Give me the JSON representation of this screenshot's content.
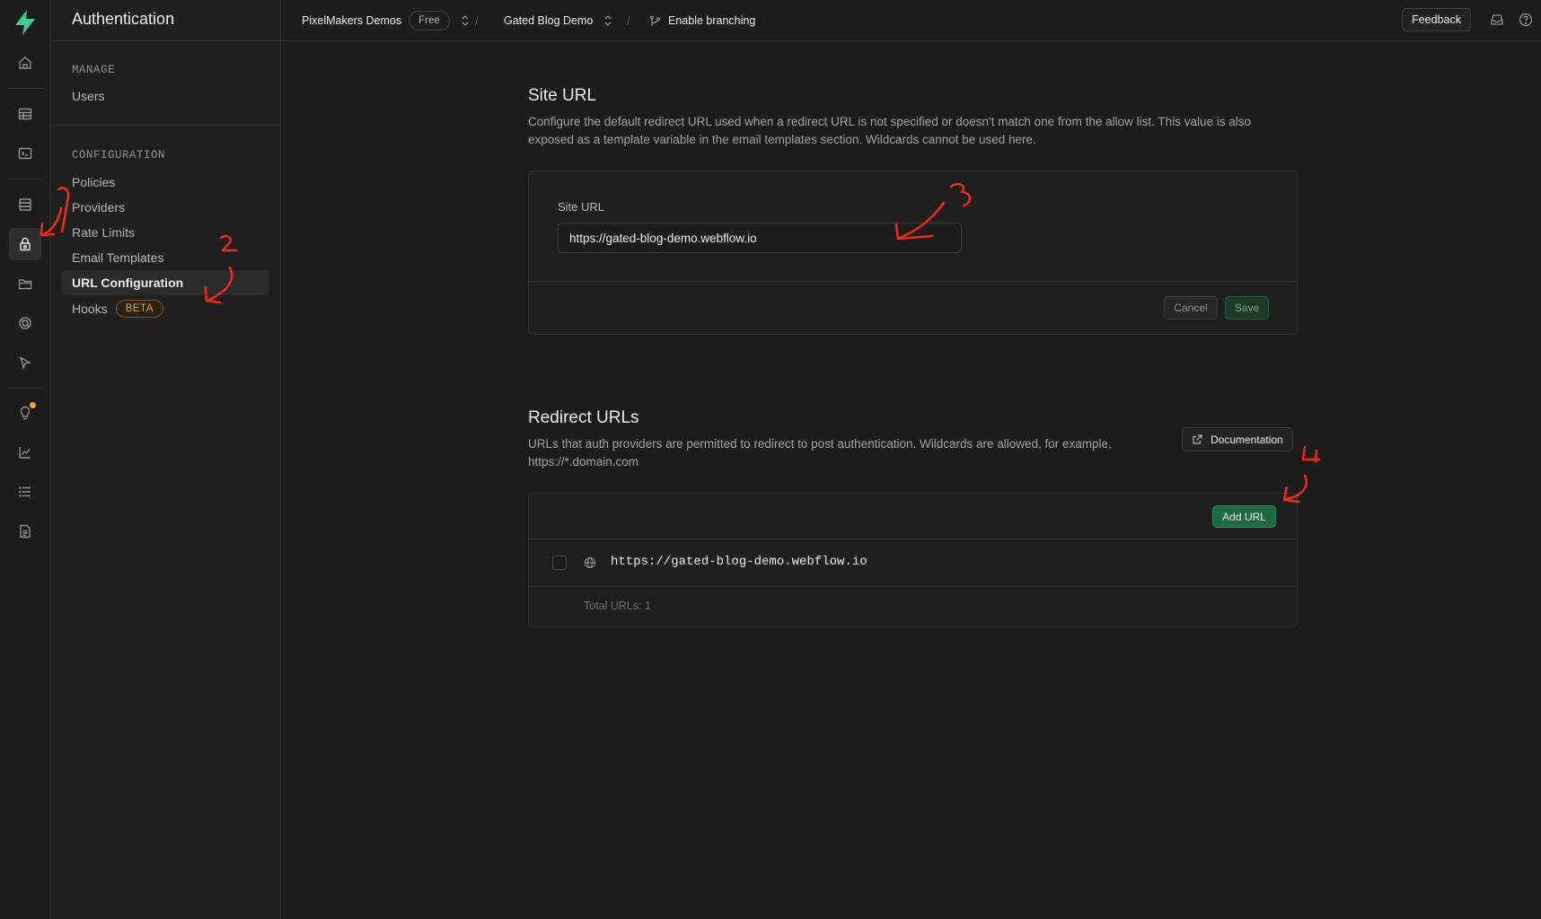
{
  "sidebar": {
    "title": "Authentication",
    "manage_heading": "MANAGE",
    "manage_items": [
      {
        "label": "Users"
      }
    ],
    "config_heading": "CONFIGURATION",
    "config_items": [
      {
        "label": "Policies"
      },
      {
        "label": "Providers"
      },
      {
        "label": "Rate Limits"
      },
      {
        "label": "Email Templates"
      },
      {
        "label": "URL Configuration"
      },
      {
        "label": "Hooks",
        "badge": "BETA"
      }
    ]
  },
  "rail": {
    "icons": [
      "home-icon",
      "table-editor-icon",
      "sql-editor-icon",
      "database-icon",
      "authentication-icon",
      "storage-icon",
      "realtime-icon",
      "edge-functions-icon",
      "advisors-icon",
      "reports-icon",
      "logs-icon",
      "api-docs-icon"
    ],
    "active": "authentication-icon"
  },
  "topbar": {
    "org": "PixelMakers Demos",
    "plan": "Free",
    "project": "Gated Blog Demo",
    "branching": "Enable branching",
    "feedback": "Feedback"
  },
  "site_url": {
    "title": "Site URL",
    "description": "Configure the default redirect URL used when a redirect URL is not specified or doesn't match one from the allow list. This value is also exposed as a template variable in the email templates section. Wildcards cannot be used here.",
    "field_label": "Site URL",
    "value": "https://gated-blog-demo.webflow.io",
    "cancel": "Cancel",
    "save": "Save"
  },
  "redirect_urls": {
    "title": "Redirect URLs",
    "description": "URLs that auth providers are permitted to redirect to post authentication. Wildcards are allowed, for example, https://*.domain.com",
    "documentation": "Documentation",
    "add_url": "Add URL",
    "urls": [
      "https://gated-blog-demo.webflow.io"
    ],
    "total": "Total URLs: 1"
  },
  "annotations": [
    "1",
    "2",
    "3",
    "4"
  ],
  "colors": {
    "accent_green": "#3ecf8e",
    "annotation_red": "#e8291c",
    "beta_orange": "#f1a10d"
  }
}
